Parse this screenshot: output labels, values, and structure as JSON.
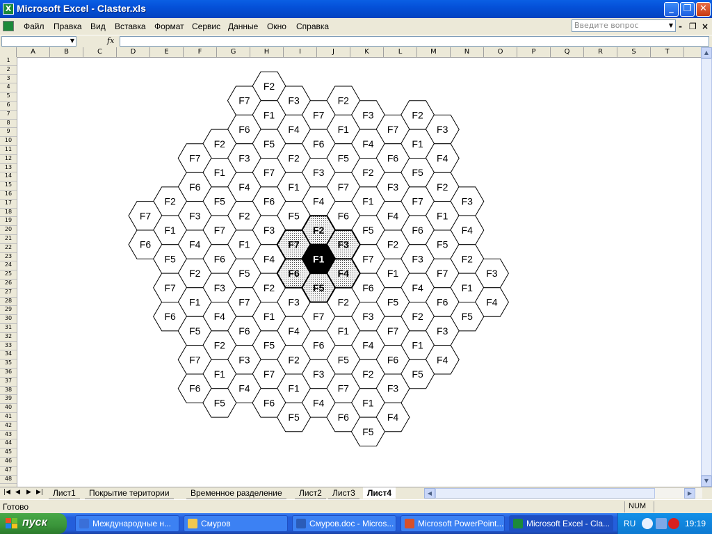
{
  "window": {
    "title": "Microsoft Excel - Claster.xls",
    "controls": {
      "minimize": "_",
      "restore": "❐",
      "close": "✕"
    }
  },
  "menu": {
    "items": [
      "Файл",
      "Правка",
      "Вид",
      "Вставка",
      "Формат",
      "Сервис",
      "Данные",
      "Окно",
      "Справка"
    ],
    "ask_placeholder": "Введите вопрос",
    "doc_controls": {
      "minimize": "-",
      "restore": "❐",
      "close": "×"
    }
  },
  "formula_bar": {
    "name_box": "",
    "fx": "fx",
    "content": ""
  },
  "columns": [
    "A",
    "B",
    "C",
    "D",
    "E",
    "F",
    "G",
    "H",
    "I",
    "J",
    "K",
    "L",
    "M",
    "N",
    "O",
    "P",
    "Q",
    "R",
    "S",
    "T"
  ],
  "rows": [
    "1",
    "2",
    "3",
    "4",
    "5",
    "6",
    "7",
    "8",
    "9",
    "10",
    "11",
    "12",
    "13",
    "14",
    "15",
    "16",
    "17",
    "18",
    "19",
    "20",
    "21",
    "22",
    "23",
    "24",
    "25",
    "26",
    "27",
    "28",
    "29",
    "30",
    "31",
    "32",
    "33",
    "34",
    "35",
    "36",
    "37",
    "38",
    "39",
    "40",
    "41",
    "42",
    "43",
    "44",
    "45",
    "46",
    "47",
    "48"
  ],
  "cluster_diagram": {
    "center": "F1",
    "highlight_colors": {
      "center_fill": "#000000",
      "neighbor_fill": "#d8d8d8",
      "cell_fill": "#ffffff",
      "stroke": "#000000"
    },
    "cells": [
      {
        "col": 5,
        "row": 0,
        "label": "F2"
      },
      {
        "col": 4,
        "row": 1,
        "label": "F7"
      },
      {
        "col": 6,
        "row": 1,
        "label": "F3"
      },
      {
        "col": 8,
        "row": 1,
        "label": "F2"
      },
      {
        "col": 5,
        "row": 2,
        "label": "F1"
      },
      {
        "col": 7,
        "row": 2,
        "label": "F7"
      },
      {
        "col": 9,
        "row": 2,
        "label": "F3"
      },
      {
        "col": 11,
        "row": 2,
        "label": "F2"
      },
      {
        "col": 4,
        "row": 3,
        "label": "F6"
      },
      {
        "col": 6,
        "row": 3,
        "label": "F4"
      },
      {
        "col": 8,
        "row": 3,
        "label": "F1"
      },
      {
        "col": 10,
        "row": 3,
        "label": "F7"
      },
      {
        "col": 12,
        "row": 3,
        "label": "F3"
      },
      {
        "col": 3,
        "row": 4,
        "label": "F2"
      },
      {
        "col": 5,
        "row": 4,
        "label": "F5"
      },
      {
        "col": 7,
        "row": 4,
        "label": "F6"
      },
      {
        "col": 9,
        "row": 4,
        "label": "F4"
      },
      {
        "col": 11,
        "row": 4,
        "label": "F1"
      },
      {
        "col": 2,
        "row": 5,
        "label": "F7"
      },
      {
        "col": 4,
        "row": 5,
        "label": "F3"
      },
      {
        "col": 6,
        "row": 5,
        "label": "F2"
      },
      {
        "col": 8,
        "row": 5,
        "label": "F5"
      },
      {
        "col": 10,
        "row": 5,
        "label": "F6"
      },
      {
        "col": 12,
        "row": 5,
        "label": "F4"
      },
      {
        "col": 3,
        "row": 6,
        "label": "F1"
      },
      {
        "col": 5,
        "row": 6,
        "label": "F7"
      },
      {
        "col": 7,
        "row": 6,
        "label": "F3"
      },
      {
        "col": 9,
        "row": 6,
        "label": "F2"
      },
      {
        "col": 11,
        "row": 6,
        "label": "F5"
      },
      {
        "col": 2,
        "row": 7,
        "label": "F6"
      },
      {
        "col": 4,
        "row": 7,
        "label": "F4"
      },
      {
        "col": 6,
        "row": 7,
        "label": "F1"
      },
      {
        "col": 8,
        "row": 7,
        "label": "F7"
      },
      {
        "col": 10,
        "row": 7,
        "label": "F3"
      },
      {
        "col": 12,
        "row": 7,
        "label": "F2"
      },
      {
        "col": 1,
        "row": 8,
        "label": "F2"
      },
      {
        "col": 3,
        "row": 8,
        "label": "F5"
      },
      {
        "col": 5,
        "row": 8,
        "label": "F6"
      },
      {
        "col": 7,
        "row": 8,
        "label": "F4"
      },
      {
        "col": 9,
        "row": 8,
        "label": "F1"
      },
      {
        "col": 11,
        "row": 8,
        "label": "F7"
      },
      {
        "col": 13,
        "row": 8,
        "label": "F3"
      },
      {
        "col": 0,
        "row": 9,
        "label": "F7"
      },
      {
        "col": 2,
        "row": 9,
        "label": "F3"
      },
      {
        "col": 4,
        "row": 9,
        "label": "F2"
      },
      {
        "col": 6,
        "row": 9,
        "label": "F5"
      },
      {
        "col": 8,
        "row": 9,
        "label": "F6"
      },
      {
        "col": 10,
        "row": 9,
        "label": "F4"
      },
      {
        "col": 12,
        "row": 9,
        "label": "F1"
      },
      {
        "col": 1,
        "row": 10,
        "label": "F1"
      },
      {
        "col": 3,
        "row": 10,
        "label": "F7"
      },
      {
        "col": 5,
        "row": 10,
        "label": "F3"
      },
      {
        "col": 7,
        "row": 10,
        "label": "F2",
        "hl": "n"
      },
      {
        "col": 9,
        "row": 10,
        "label": "F5"
      },
      {
        "col": 11,
        "row": 10,
        "label": "F6"
      },
      {
        "col": 13,
        "row": 10,
        "label": "F4"
      },
      {
        "col": 0,
        "row": 11,
        "label": "F6"
      },
      {
        "col": 2,
        "row": 11,
        "label": "F4"
      },
      {
        "col": 4,
        "row": 11,
        "label": "F1"
      },
      {
        "col": 6,
        "row": 11,
        "label": "F7",
        "hl": "n"
      },
      {
        "col": 8,
        "row": 11,
        "label": "F3",
        "hl": "n"
      },
      {
        "col": 10,
        "row": 11,
        "label": "F2"
      },
      {
        "col": 12,
        "row": 11,
        "label": "F5"
      },
      {
        "col": 1,
        "row": 12,
        "label": "F5"
      },
      {
        "col": 3,
        "row": 12,
        "label": "F6"
      },
      {
        "col": 5,
        "row": 12,
        "label": "F4"
      },
      {
        "col": 7,
        "row": 12,
        "label": "F1",
        "hl": "c"
      },
      {
        "col": 9,
        "row": 12,
        "label": "F7"
      },
      {
        "col": 11,
        "row": 12,
        "label": "F3"
      },
      {
        "col": 13,
        "row": 12,
        "label": "F2"
      },
      {
        "col": 2,
        "row": 13,
        "label": "F2"
      },
      {
        "col": 4,
        "row": 13,
        "label": "F5"
      },
      {
        "col": 6,
        "row": 13,
        "label": "F6",
        "hl": "n"
      },
      {
        "col": 8,
        "row": 13,
        "label": "F4",
        "hl": "n"
      },
      {
        "col": 10,
        "row": 13,
        "label": "F1"
      },
      {
        "col": 12,
        "row": 13,
        "label": "F7"
      },
      {
        "col": 14,
        "row": 13,
        "label": "F3"
      },
      {
        "col": 1,
        "row": 14,
        "label": "F7"
      },
      {
        "col": 3,
        "row": 14,
        "label": "F3"
      },
      {
        "col": 5,
        "row": 14,
        "label": "F2"
      },
      {
        "col": 7,
        "row": 14,
        "label": "F5",
        "hl": "n"
      },
      {
        "col": 9,
        "row": 14,
        "label": "F6"
      },
      {
        "col": 11,
        "row": 14,
        "label": "F4"
      },
      {
        "col": 13,
        "row": 14,
        "label": "F1"
      },
      {
        "col": 2,
        "row": 15,
        "label": "F1"
      },
      {
        "col": 4,
        "row": 15,
        "label": "F7"
      },
      {
        "col": 6,
        "row": 15,
        "label": "F3"
      },
      {
        "col": 8,
        "row": 15,
        "label": "F2"
      },
      {
        "col": 10,
        "row": 15,
        "label": "F5"
      },
      {
        "col": 12,
        "row": 15,
        "label": "F6"
      },
      {
        "col": 14,
        "row": 15,
        "label": "F4"
      },
      {
        "col": 1,
        "row": 16,
        "label": "F6"
      },
      {
        "col": 3,
        "row": 16,
        "label": "F4"
      },
      {
        "col": 5,
        "row": 16,
        "label": "F1"
      },
      {
        "col": 7,
        "row": 16,
        "label": "F7"
      },
      {
        "col": 9,
        "row": 16,
        "label": "F3"
      },
      {
        "col": 11,
        "row": 16,
        "label": "F2"
      },
      {
        "col": 13,
        "row": 16,
        "label": "F5"
      },
      {
        "col": 2,
        "row": 17,
        "label": "F5"
      },
      {
        "col": 4,
        "row": 17,
        "label": "F6"
      },
      {
        "col": 6,
        "row": 17,
        "label": "F4"
      },
      {
        "col": 8,
        "row": 17,
        "label": "F1"
      },
      {
        "col": 10,
        "row": 17,
        "label": "F7"
      },
      {
        "col": 12,
        "row": 17,
        "label": "F3"
      },
      {
        "col": 3,
        "row": 18,
        "label": "F2"
      },
      {
        "col": 5,
        "row": 18,
        "label": "F5"
      },
      {
        "col": 7,
        "row": 18,
        "label": "F6"
      },
      {
        "col": 9,
        "row": 18,
        "label": "F4"
      },
      {
        "col": 11,
        "row": 18,
        "label": "F1"
      },
      {
        "col": 2,
        "row": 19,
        "label": "F7"
      },
      {
        "col": 4,
        "row": 19,
        "label": "F3"
      },
      {
        "col": 6,
        "row": 19,
        "label": "F2"
      },
      {
        "col": 8,
        "row": 19,
        "label": "F5"
      },
      {
        "col": 10,
        "row": 19,
        "label": "F6"
      },
      {
        "col": 12,
        "row": 19,
        "label": "F4"
      },
      {
        "col": 3,
        "row": 20,
        "label": "F1"
      },
      {
        "col": 5,
        "row": 20,
        "label": "F7"
      },
      {
        "col": 7,
        "row": 20,
        "label": "F3"
      },
      {
        "col": 9,
        "row": 20,
        "label": "F2"
      },
      {
        "col": 11,
        "row": 20,
        "label": "F5"
      },
      {
        "col": 2,
        "row": 21,
        "label": "F6"
      },
      {
        "col": 4,
        "row": 21,
        "label": "F4"
      },
      {
        "col": 6,
        "row": 21,
        "label": "F1"
      },
      {
        "col": 8,
        "row": 21,
        "label": "F7"
      },
      {
        "col": 10,
        "row": 21,
        "label": "F3"
      },
      {
        "col": 3,
        "row": 22,
        "label": "F5"
      },
      {
        "col": 5,
        "row": 22,
        "label": "F6"
      },
      {
        "col": 7,
        "row": 22,
        "label": "F4"
      },
      {
        "col": 9,
        "row": 22,
        "label": "F1"
      },
      {
        "col": 6,
        "row": 23,
        "label": "F5"
      },
      {
        "col": 8,
        "row": 23,
        "label": "F6"
      },
      {
        "col": 10,
        "row": 23,
        "label": "F4"
      },
      {
        "col": 9,
        "row": 24,
        "label": "F5"
      }
    ]
  },
  "sheet_tabs": {
    "nav": [
      "|◀",
      "◀",
      "▶",
      "▶|"
    ],
    "tabs": [
      "Лист1",
      "Покрытие територии",
      "Временное разделение",
      "Лист2",
      "Лист3",
      "Лист4"
    ],
    "active": "Лист4"
  },
  "status": {
    "text": "Готово",
    "num": "NUM"
  },
  "taskbar": {
    "start": "пуск",
    "items": [
      {
        "label": "Международные н...",
        "icon_color": "#3a6fd8"
      },
      {
        "label": "Смуров",
        "icon_color": "#f0c850"
      },
      {
        "label": "Смуров.doc - Micros...",
        "icon_color": "#2b5cb8"
      },
      {
        "label": "Microsoft PowerPoint...",
        "icon_color": "#d8502a"
      },
      {
        "label": "Microsoft Excel - Cla...",
        "icon_color": "#1c8a3a"
      }
    ],
    "tray": {
      "lang": "RU",
      "time": "19:19"
    }
  }
}
